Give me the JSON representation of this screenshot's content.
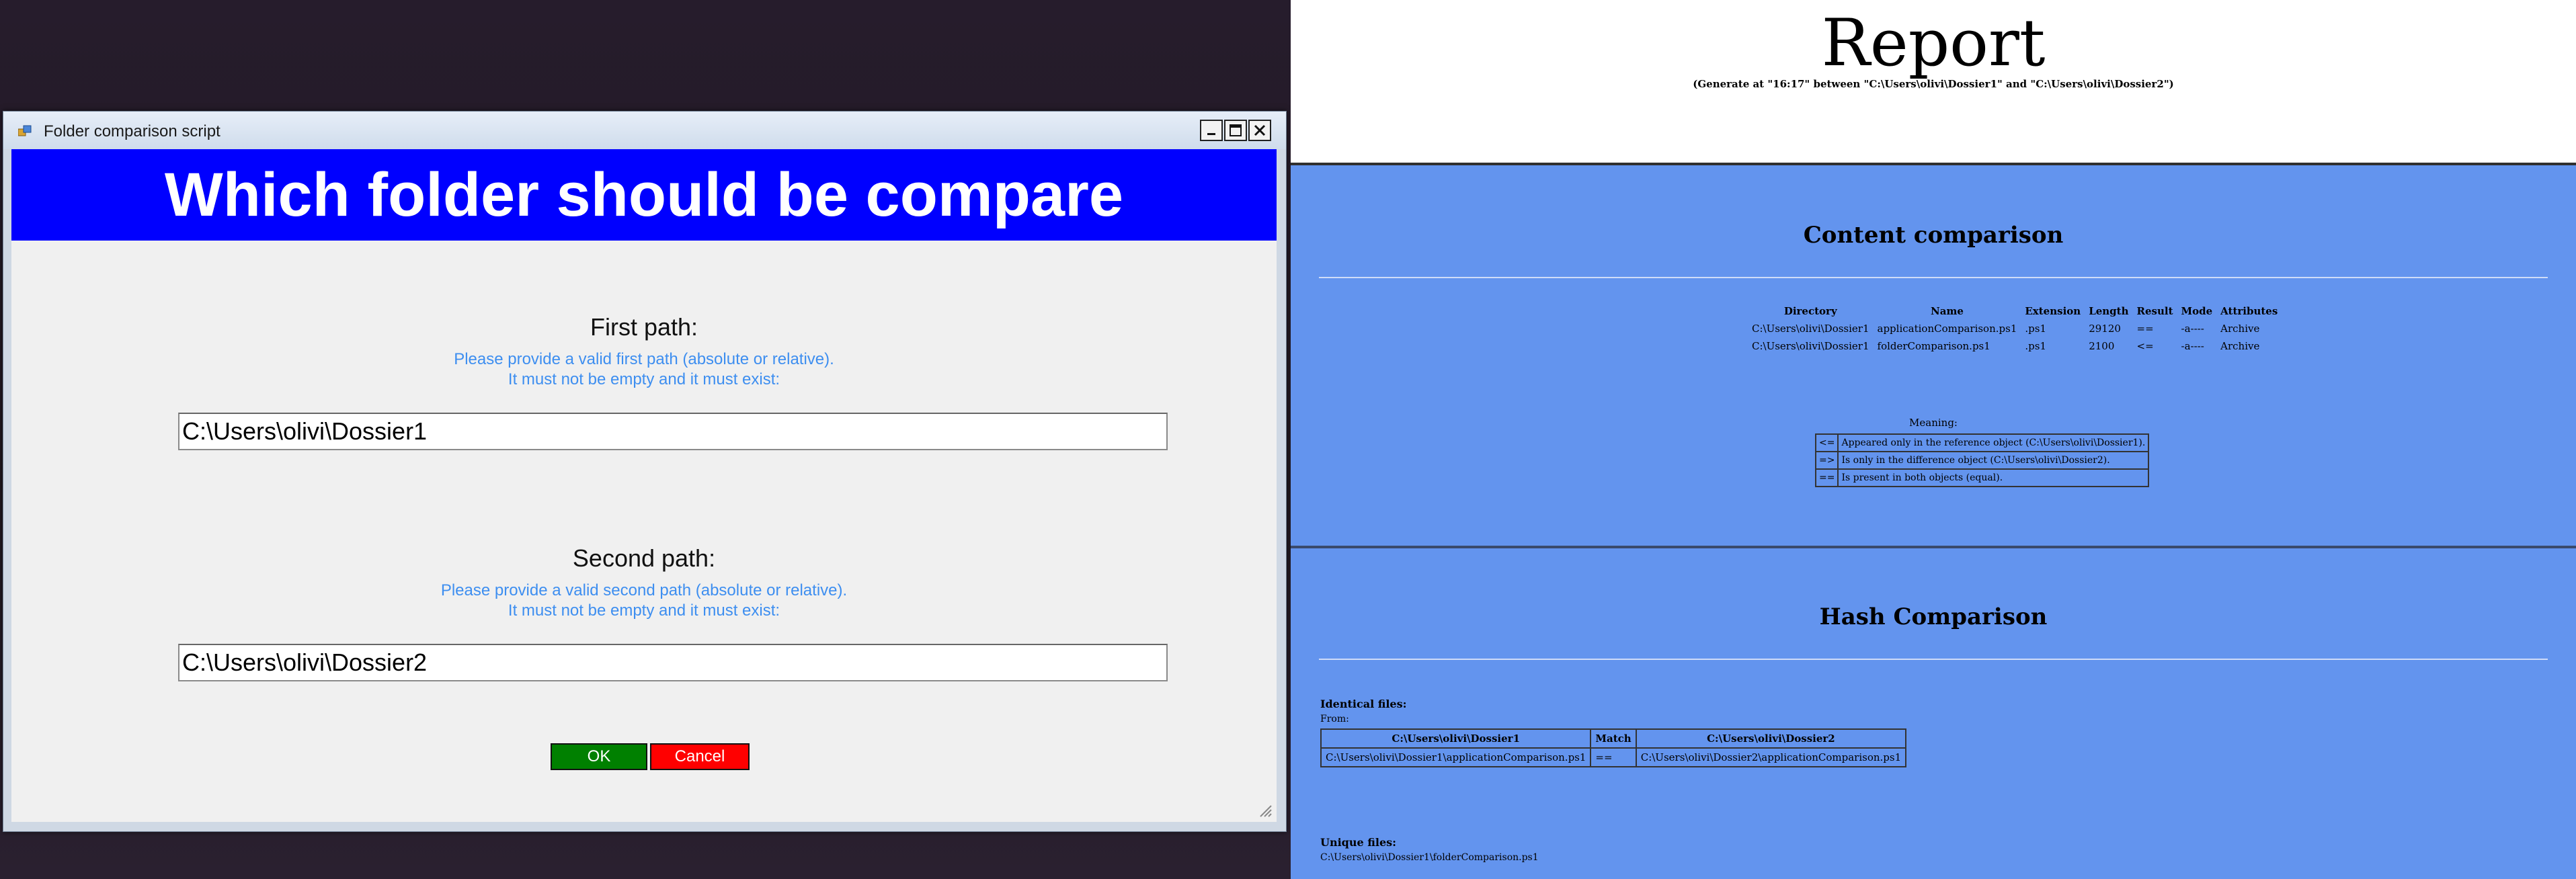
{
  "dialog": {
    "title": "Folder comparison script",
    "controls": {
      "minimize": "_",
      "maximize": "☐",
      "close": "✕"
    },
    "banner": "Which folder should be compare",
    "first": {
      "label": "First path:",
      "help_line1": "Please provide a valid first path (absolute or relative).",
      "help_line2": "It must not be empty and it must exist:",
      "value": "C:\\Users\\olivi\\Dossier1"
    },
    "second": {
      "label": "Second path:",
      "help_line1": "Please provide a valid second path (absolute or relative).",
      "help_line2": "It must not be empty and it must exist:",
      "value": "C:\\Users\\olivi\\Dossier2"
    },
    "ok_label": "OK",
    "cancel_label": "Cancel"
  },
  "report": {
    "title": "Report",
    "subtitle": "(Generate at \"16:17\" between \"C:\\Users\\olivi\\Dossier1\" and \"C:\\Users\\olivi\\Dossier2\")",
    "content": {
      "title": "Content comparison",
      "headers": [
        "Directory",
        "Name",
        "Extension",
        "Length",
        "Result",
        "Mode",
        "Attributes"
      ],
      "rows": [
        [
          "C:\\Users\\olivi\\Dossier1",
          "applicationComparison.ps1",
          ".ps1",
          "29120",
          "==",
          "-a----",
          "Archive"
        ],
        [
          "C:\\Users\\olivi\\Dossier1",
          "folderComparison.ps1",
          ".ps1",
          "2100",
          "<=",
          "-a----",
          "Archive"
        ]
      ],
      "meaning_label": "Meaning:",
      "meaning": [
        [
          "<=",
          "Appeared only in the reference object (C:\\Users\\olivi\\Dossier1)."
        ],
        [
          "=>",
          "Is only in the difference object (C:\\Users\\olivi\\Dossier2)."
        ],
        [
          "==",
          "Is present in both objects (equal)."
        ]
      ]
    },
    "hash": {
      "title": "Hash Comparison",
      "identical_label": "Identical files:",
      "from_label": "From:",
      "headers": [
        "C:\\Users\\olivi\\Dossier1",
        "Match",
        "C:\\Users\\olivi\\Dossier2"
      ],
      "row": [
        "C:\\Users\\olivi\\Dossier1\\applicationComparison.ps1",
        "==",
        "C:\\Users\\olivi\\Dossier2\\applicationComparison.ps1"
      ],
      "unique_label": "Unique files:",
      "unique_file": "C:\\Users\\olivi\\Dossier1\\folderComparison.ps1"
    }
  }
}
